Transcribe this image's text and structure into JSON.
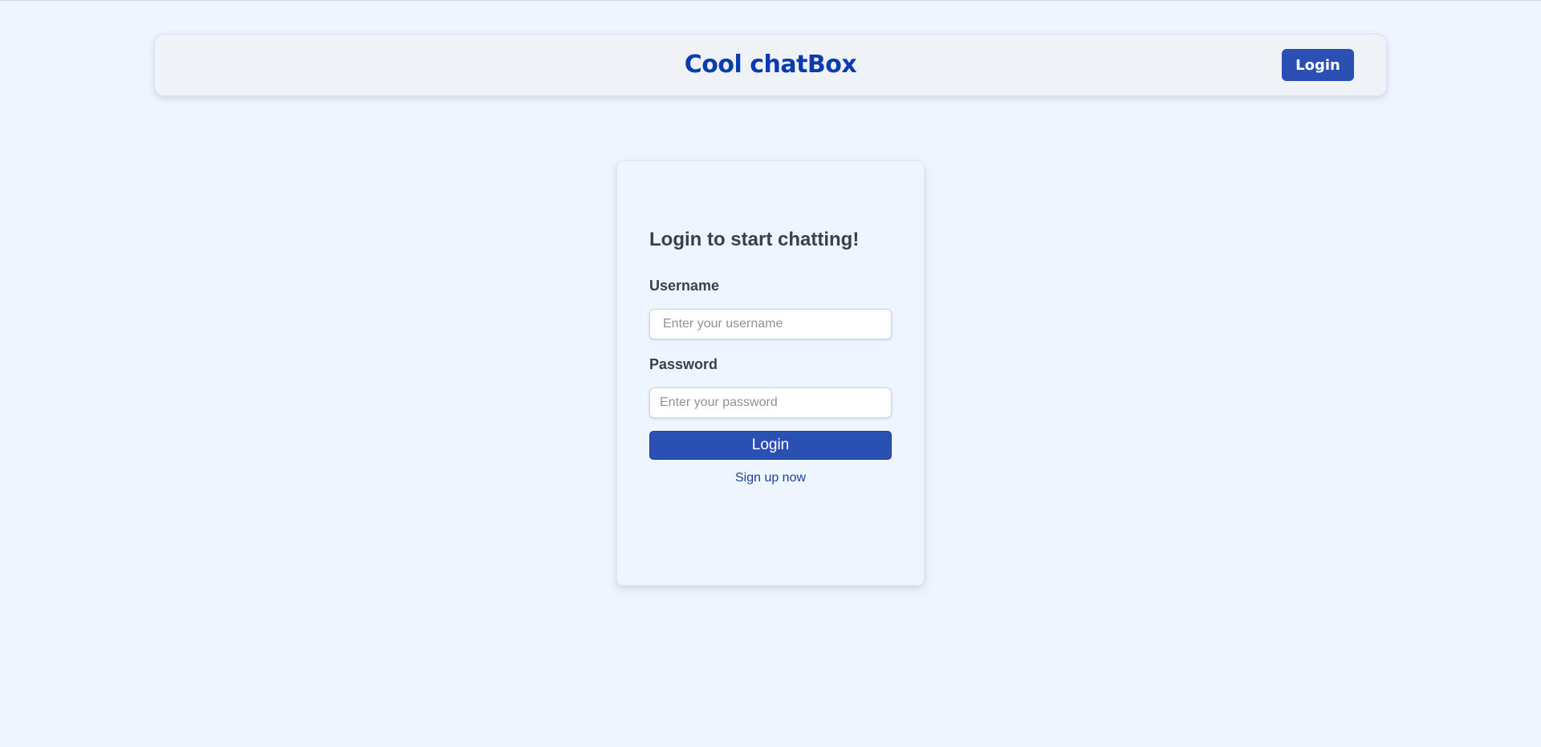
{
  "header": {
    "brand": "Cool chatBox",
    "login_label": "Login"
  },
  "login_form": {
    "title": "Login to start chatting!",
    "username_label": "Username",
    "username_placeholder": "Enter your username",
    "username_value": "",
    "password_label": "Password",
    "password_placeholder": "Enter your password",
    "password_value": "",
    "submit_label": "Login",
    "signup_link": "Sign up now"
  },
  "colors": {
    "background": "#eff5ff",
    "brand": "#0b3bb3",
    "primary_button": "#2b50b4",
    "link": "#1e3fa0",
    "text": "#374151"
  }
}
